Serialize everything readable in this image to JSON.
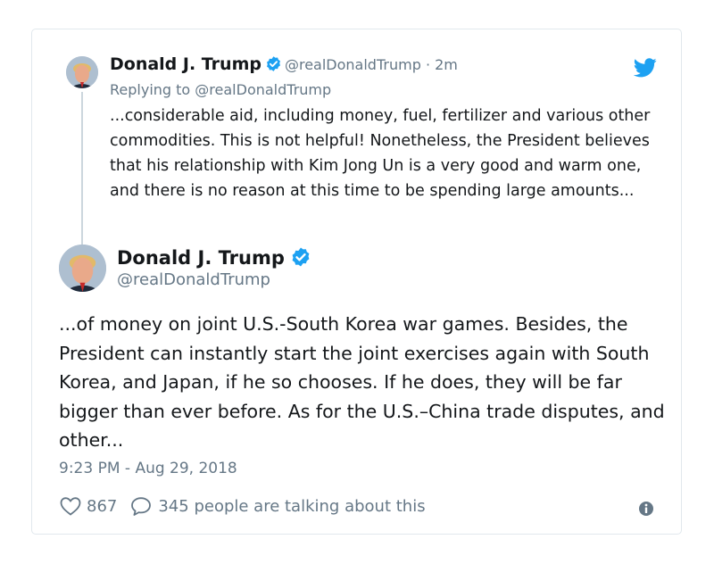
{
  "parent_tweet": {
    "display_name": "Donald J. Trump",
    "handle": "@realDonaldTrump",
    "separator": "·",
    "time_ago": "2m",
    "replying_prefix": "Replying to",
    "replying_to": "@realDonaldTrump",
    "text": "...considerable aid, including money, fuel, fertilizer and various other commodities. This is not helpful! Nonetheless, the President believes that his relationship with Kim Jong Un is a very good and warm one, and there is no reason at this time to be spending large amounts..."
  },
  "main_tweet": {
    "display_name": "Donald J. Trump",
    "handle": "@realDonaldTrump",
    "text": "...of money on joint U.S.-South Korea war games. Besides, the President can instantly start the joint exercises again with South Korea, and Japan, if he so chooses. If he does, they will be far bigger than ever before. As for the U.S.–China trade disputes, and other...",
    "timestamp": "9:23 PM - Aug 29, 2018",
    "like_count": "867",
    "talking_text": "345 people are talking about this"
  },
  "icons": {
    "verified": "verified-badge-icon",
    "brand": "twitter-bird-icon",
    "like": "heart-icon",
    "reply": "speech-bubble-icon",
    "info": "info-icon"
  },
  "colors": {
    "brand_blue": "#1da1f2",
    "text": "#14171a",
    "secondary_text": "#657786",
    "border": "#e1e8ed"
  }
}
